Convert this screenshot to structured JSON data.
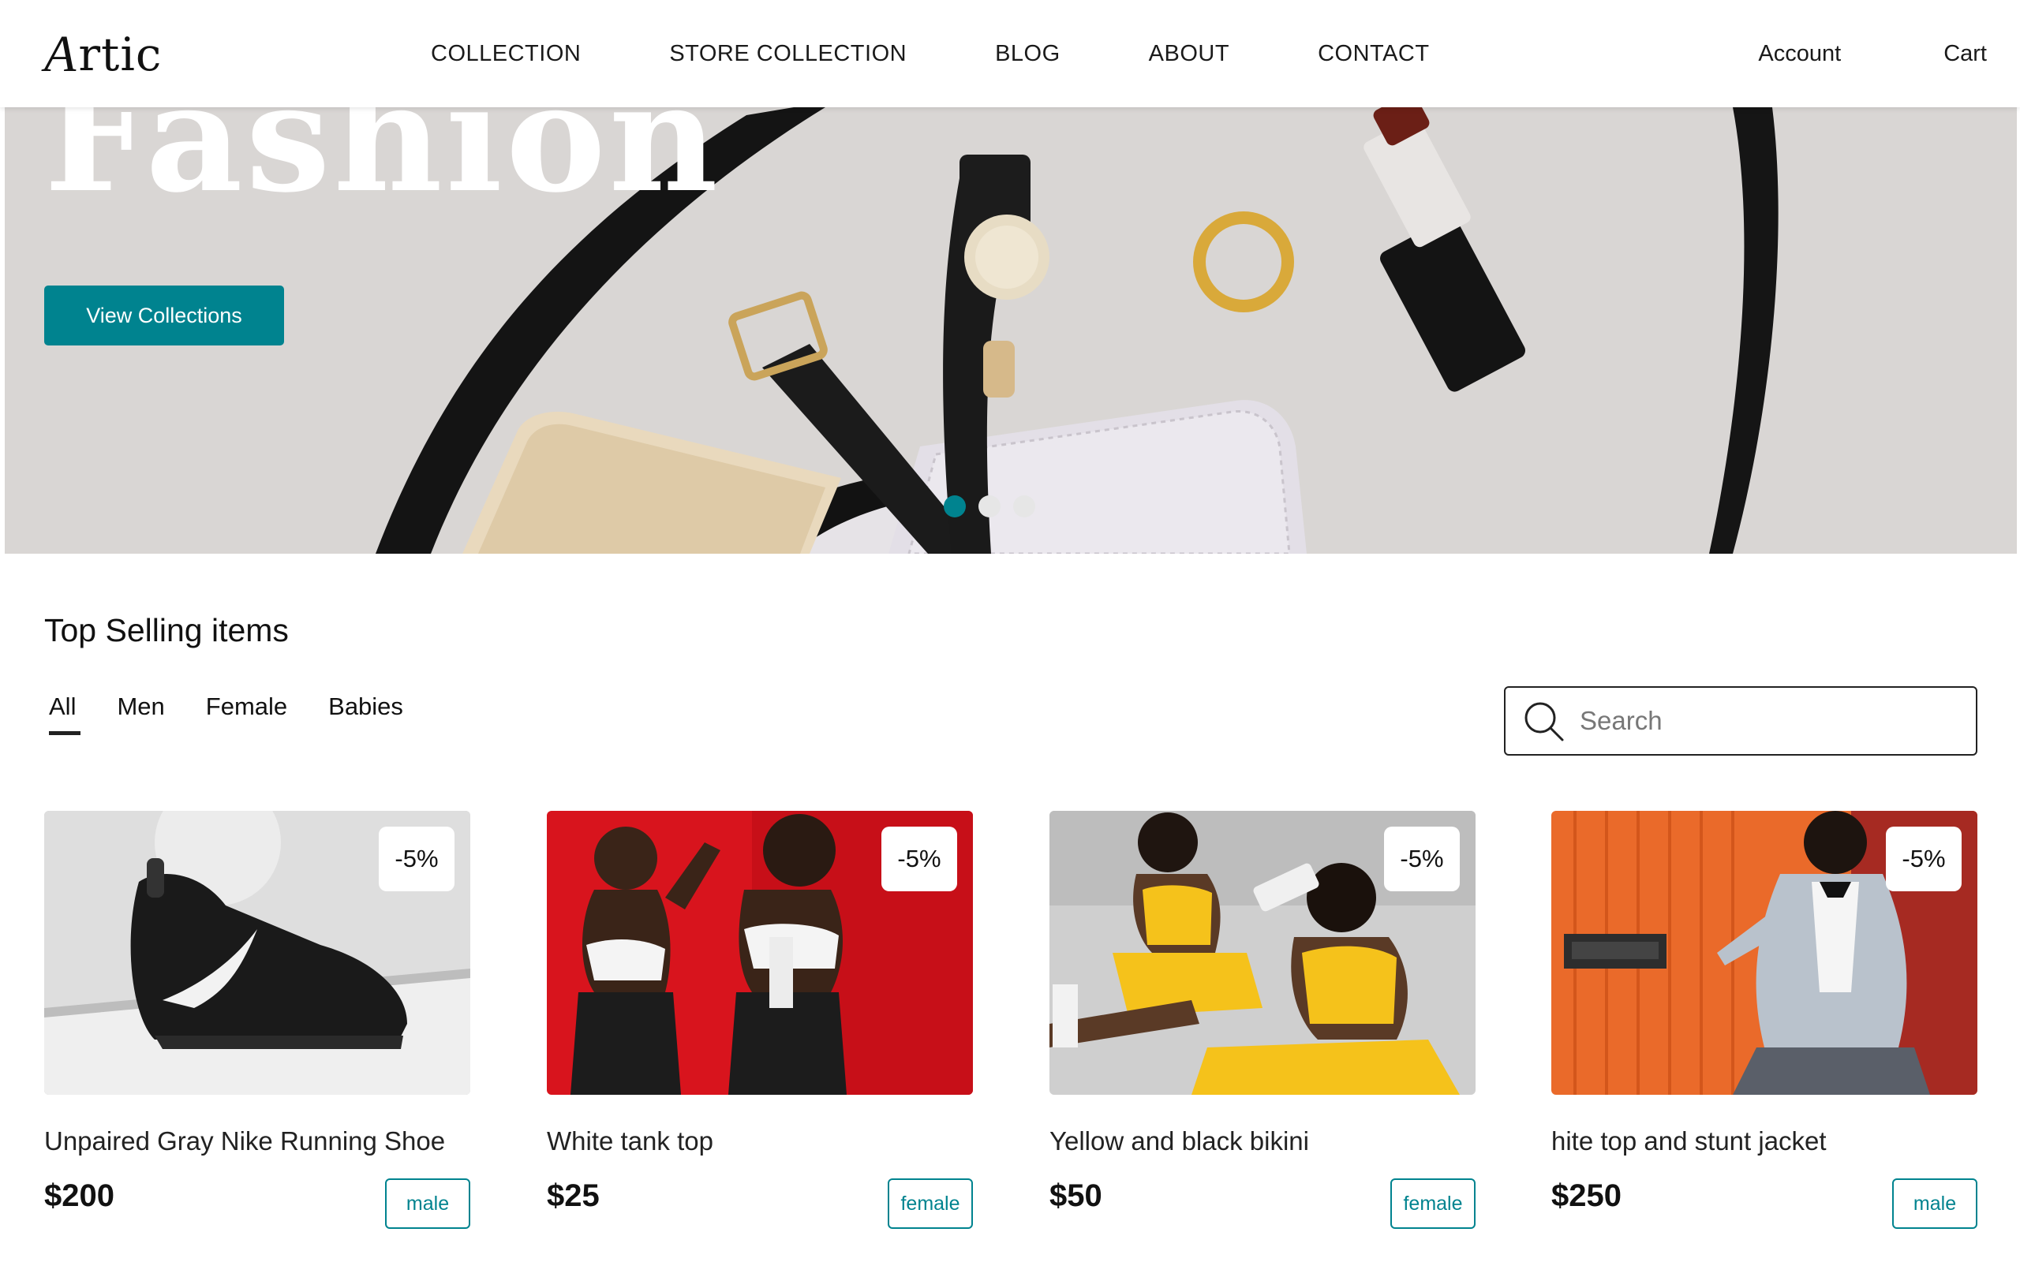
{
  "header": {
    "logo_text": "rtic",
    "logo_mark": "A",
    "nav": [
      "COLLECTION",
      "STORE COLLECTION",
      "BLOG",
      "ABOUT",
      "CONTACT"
    ],
    "account": "Account",
    "cart": "Cart"
  },
  "hero": {
    "title": "Fashion",
    "cta": "View Collections",
    "slides": 3,
    "active_slide": 1,
    "accent_color": "#00838f"
  },
  "top_selling": {
    "title": "Top Selling items",
    "tabs": [
      "All",
      "Men",
      "Female",
      "Babies"
    ],
    "active_tab": "All",
    "search": {
      "placeholder": "Search",
      "value": ""
    },
    "products": [
      {
        "name": "Unpaired Gray Nike Running Shoe",
        "price": "$200",
        "badge": "-5%",
        "tag": "male",
        "image": "black-sneaker-photo"
      },
      {
        "name": "White tank top",
        "price": "$25",
        "badge": "-5%",
        "tag": "female",
        "image": "two-women-red-wall-photo"
      },
      {
        "name": "Yellow and black bikini",
        "price": "$50",
        "badge": "-5%",
        "tag": "female",
        "image": "women-yellow-sportswear-photo"
      },
      {
        "name": "hite top and stunt jacket",
        "price": "$250",
        "badge": "-5%",
        "tag": "male",
        "image": "man-jacket-orange-door-photo"
      }
    ]
  }
}
